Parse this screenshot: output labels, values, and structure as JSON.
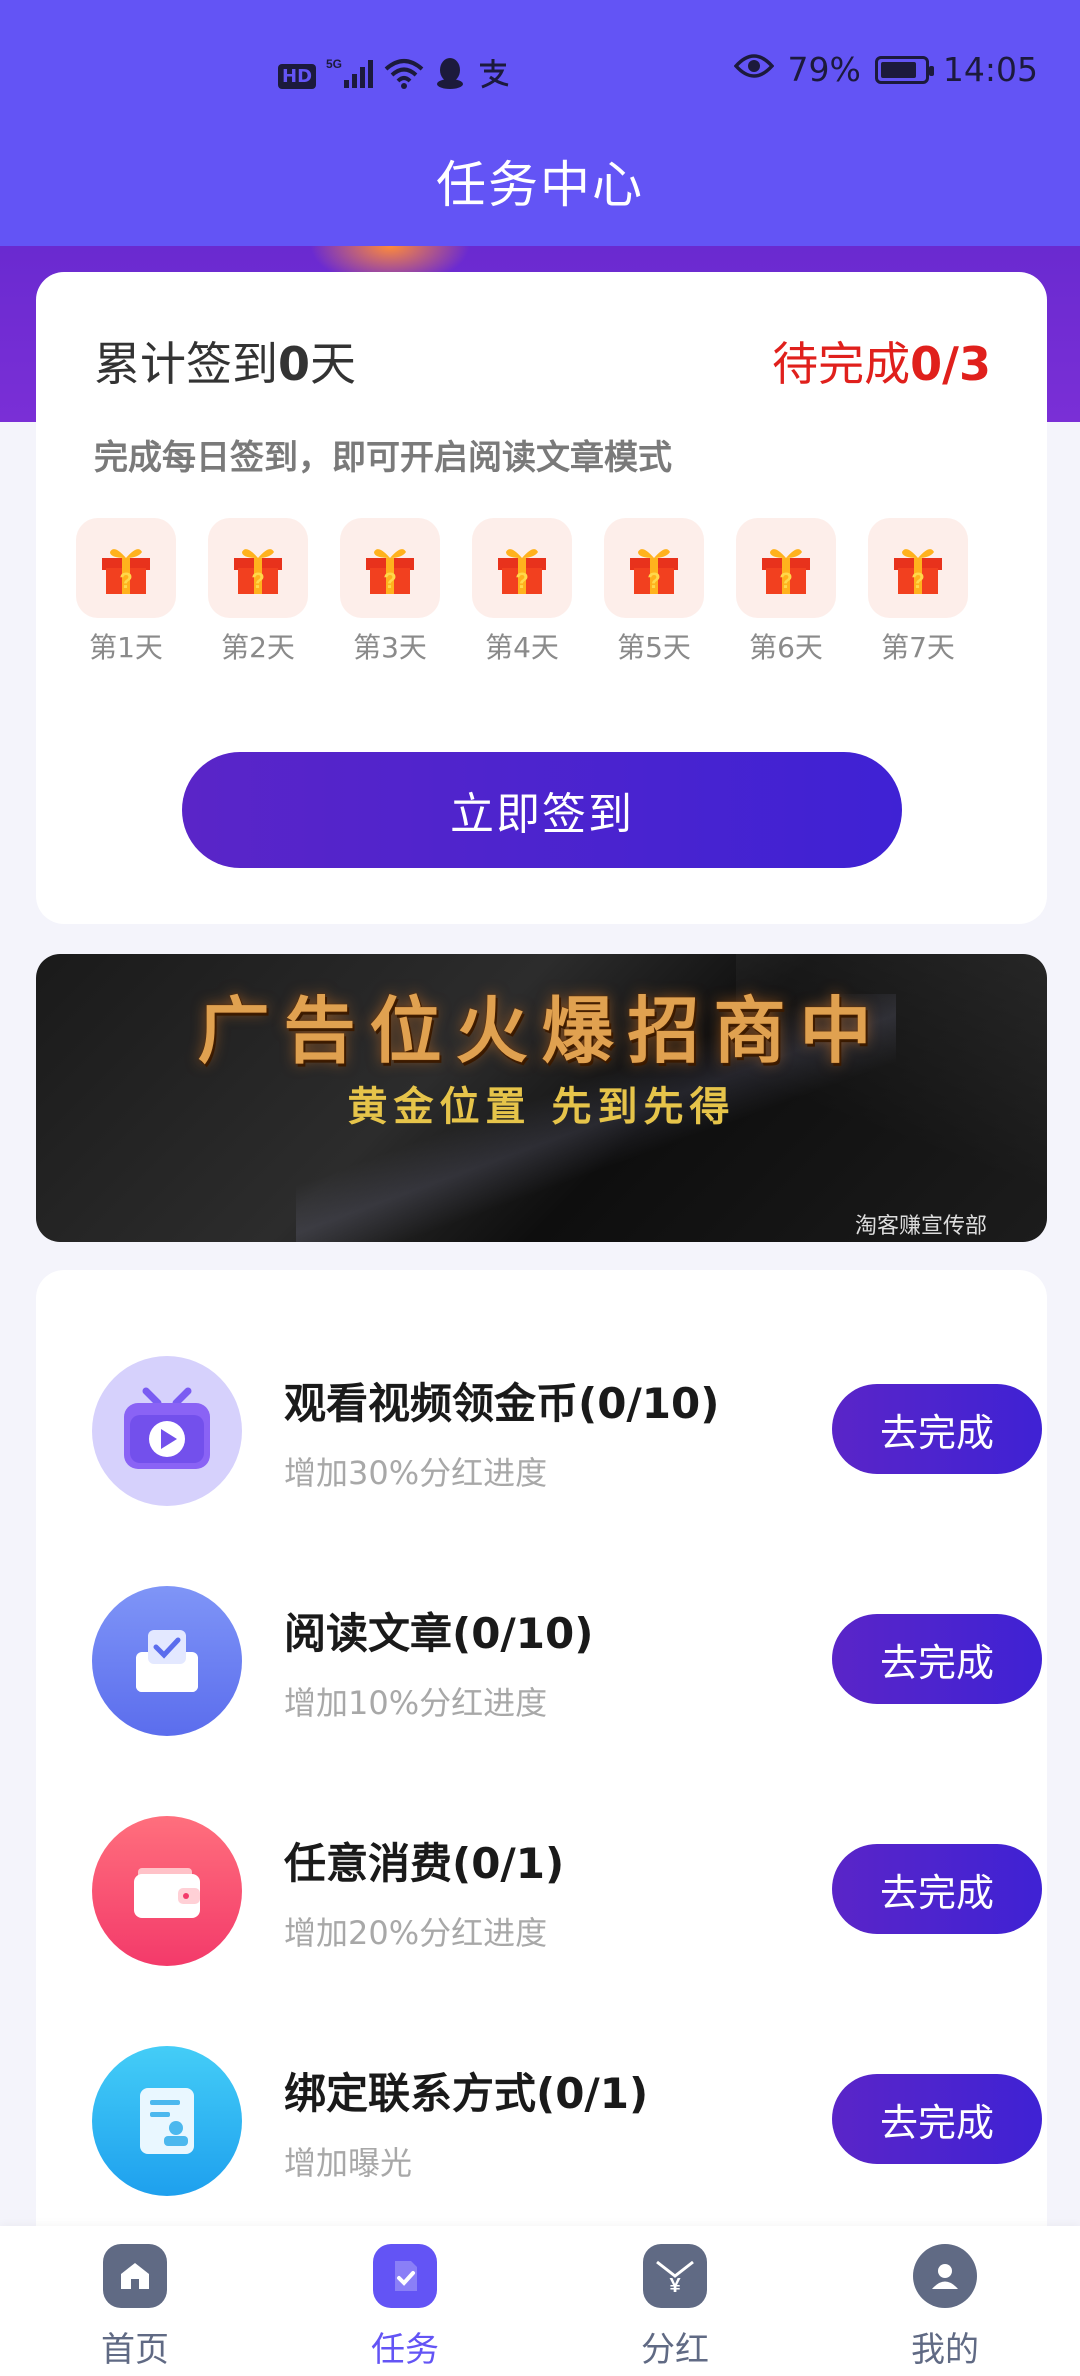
{
  "status_bar": {
    "hd": "HD",
    "net": "5G",
    "battery_pct": "79%",
    "battery_level": 0.79,
    "time": "14:05"
  },
  "header": {
    "title": "任务中心"
  },
  "signin": {
    "total_prefix": "累计签到",
    "total_days": "0",
    "total_suffix": "天",
    "pending_prefix": "待完成",
    "pending_value": "0/3",
    "subtitle": "完成每日签到，即可开启阅读文章模式",
    "days": [
      "第1天",
      "第2天",
      "第3天",
      "第4天",
      "第5天",
      "第6天",
      "第7天"
    ],
    "button": "立即签到"
  },
  "ad": {
    "title": "广告位火爆招商中",
    "subtitle": "黄金位置  先到先得",
    "footer": "淘客赚宣传部"
  },
  "tasks": [
    {
      "name": "观看视频领金币(0/10)",
      "desc": "增加30%分红进度",
      "button": "去完成",
      "icon": "video-icon",
      "color": "#c9c3fb"
    },
    {
      "name": "阅读文章(0/10)",
      "desc": "增加10%分红进度",
      "button": "去完成",
      "icon": "article-icon",
      "color": "#6f86f0"
    },
    {
      "name": "任意消费(0/1)",
      "desc": "增加20%分红进度",
      "button": "去完成",
      "icon": "wallet-icon",
      "color": "#f5486e"
    },
    {
      "name": "绑定联系方式(0/1)",
      "desc": "增加曝光",
      "button": "去完成",
      "icon": "contact-card-icon",
      "color": "#2fb5f2"
    }
  ],
  "bottom_nav": [
    {
      "label": "首页",
      "icon": "home-icon",
      "active": false
    },
    {
      "label": "任务",
      "icon": "task-doc-icon",
      "active": true
    },
    {
      "label": "分红",
      "icon": "dividend-envelope-icon",
      "active": false
    },
    {
      "label": "我的",
      "icon": "profile-icon",
      "active": false
    }
  ],
  "colors": {
    "header": "#6354f5",
    "accent_red": "#e0201c",
    "button_gradient_start": "#5a25c8",
    "button_gradient_end": "#3f22d4",
    "nav_active": "#6354f5",
    "nav_inactive": "#606a84"
  }
}
